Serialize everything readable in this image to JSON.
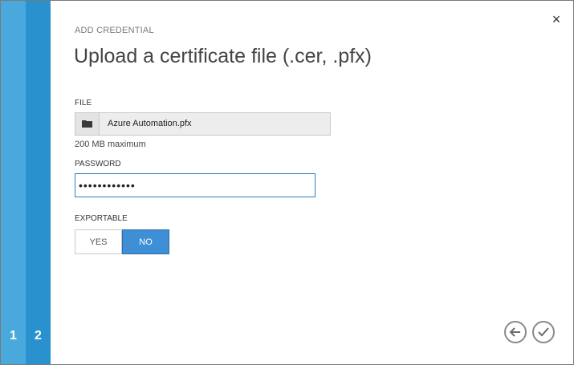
{
  "dialog": {
    "subtitle": "ADD CREDENTIAL",
    "title": "Upload a certificate file (.cer, .pfx)",
    "close_symbol": "×"
  },
  "steps": [
    "1",
    "2"
  ],
  "file": {
    "label": "FILE",
    "file_name": "Azure Automation.pfx",
    "hint": "200 MB maximum"
  },
  "password": {
    "label": "PASSWORD",
    "value": "••••••••••••"
  },
  "exportable": {
    "label": "EXPORTABLE",
    "options": [
      "YES",
      "NO"
    ],
    "selected": "NO"
  },
  "colors": {
    "rail_step1": "#49a9dd",
    "rail_step2": "#2a91cf",
    "accent": "#3e8fd6"
  },
  "icons": {
    "close": "close-icon",
    "folder": "folder-icon",
    "back": "back-arrow-icon",
    "ok": "checkmark-icon"
  }
}
